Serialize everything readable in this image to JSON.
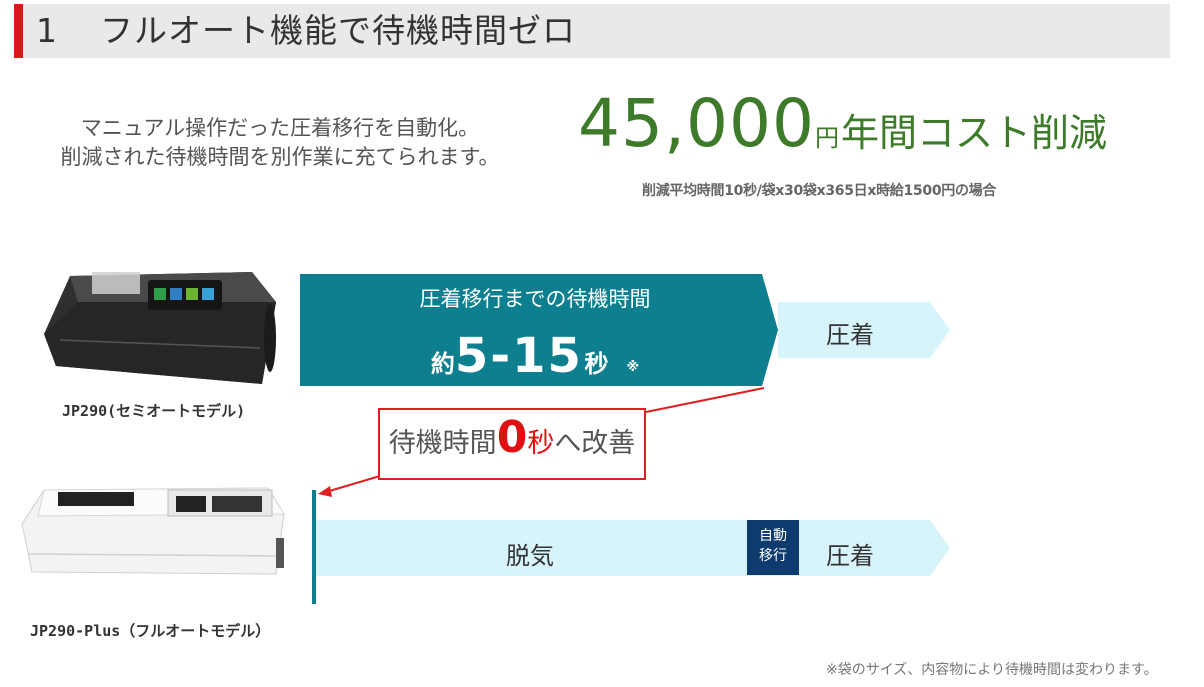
{
  "header": {
    "number": "1",
    "title": "フルオート機能で待機時間ゼロ"
  },
  "intro": {
    "line1": "マニュアル操作だった圧着移行を自動化。",
    "line2": "削減された待機時間を別作業に充てられます。"
  },
  "savings": {
    "amount": "45,000",
    "unit": "円",
    "label": "年間コスト削減",
    "note": "削減平均時間10秒/袋x30袋x365日x時給1500円の場合"
  },
  "semi_auto": {
    "model_label": "JP290(セミオートモデル)",
    "wait_title": "圧着移行までの待機時間",
    "wait_prefix": "約",
    "wait_range": "5-15",
    "wait_unit": "秒",
    "wait_mark": "※",
    "seal_label": "圧着"
  },
  "improvement": {
    "text_pre": "待機時間",
    "zero": "0",
    "sec": "秒",
    "text_post": "へ改善"
  },
  "full_auto": {
    "model_label": "JP290-Plus（フルオートモデル）",
    "degas_label": "脱気",
    "auto_line1": "自動",
    "auto_line2": "移行",
    "seal_label": "圧着"
  },
  "footnote": "※袋のサイズ、内容物により待機時間は変わります。",
  "colors": {
    "accent_red": "#d51a1a",
    "savings_green": "#3d7a2a",
    "teal_bar": "#0d7f8f",
    "light_cyan": "#d8f4fb",
    "auto_navy": "#0e3b6e",
    "highlight_red": "#e01010"
  }
}
